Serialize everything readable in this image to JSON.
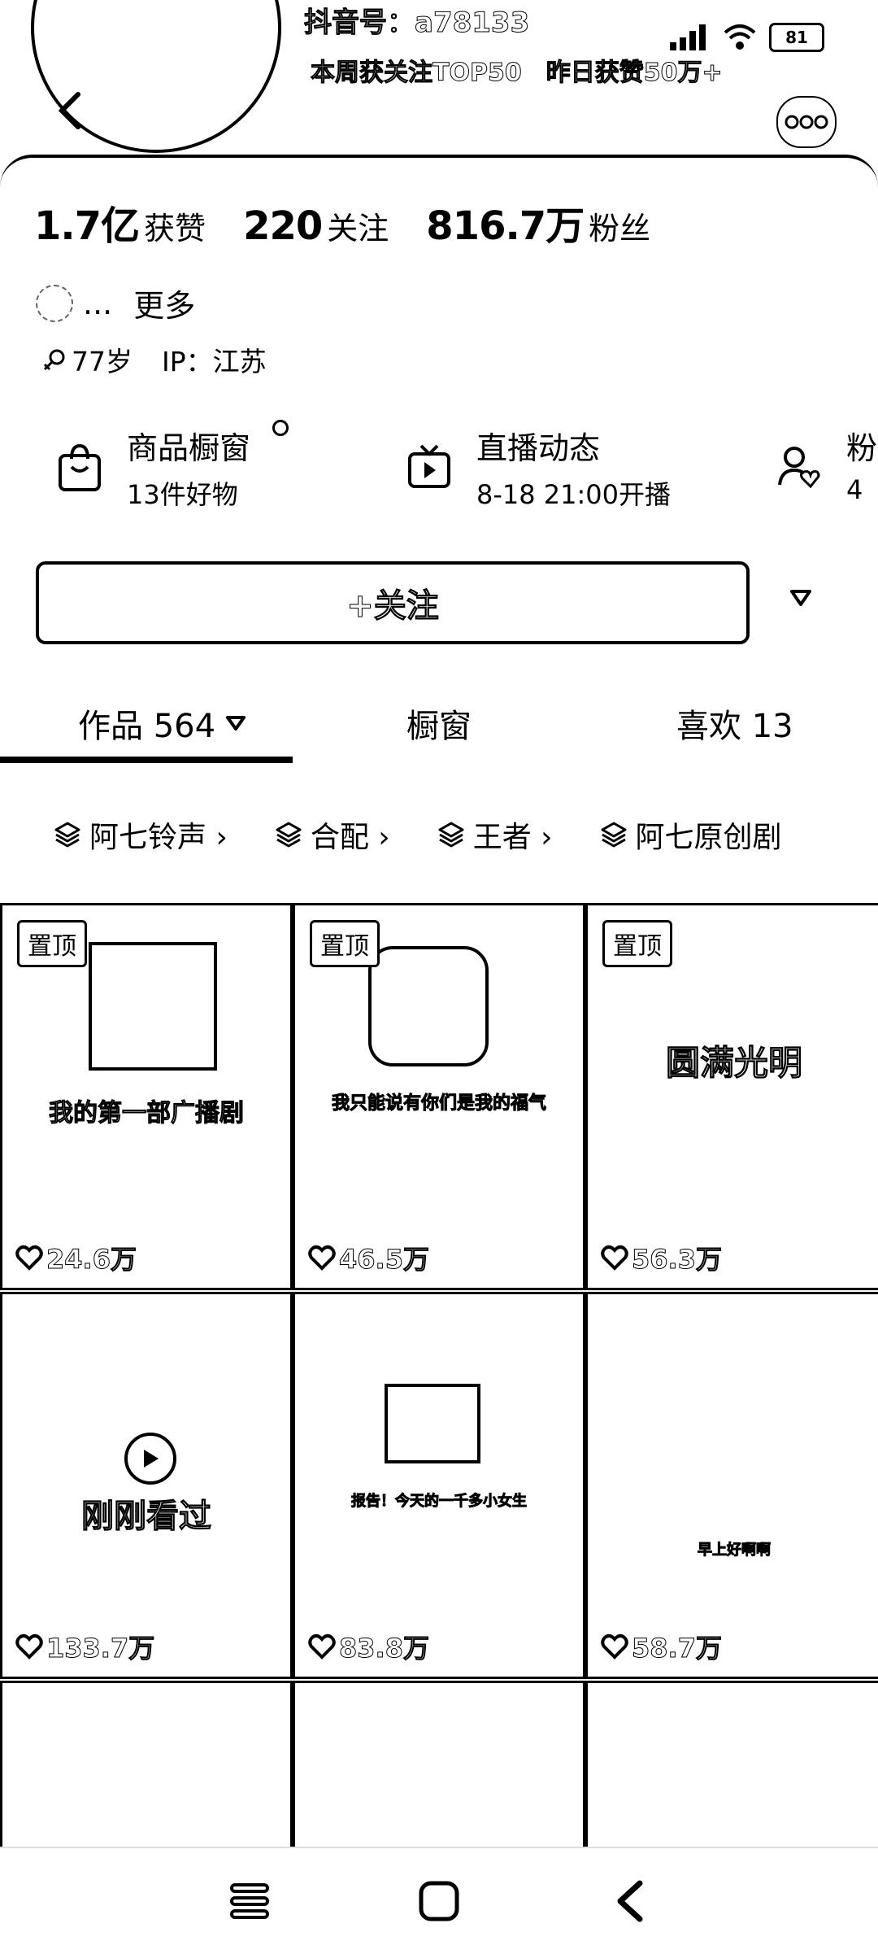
{
  "header": {
    "douyin_id": "抖音号：a78133",
    "rank_badges": "本周获关注TOP50　昨日获赞50万+",
    "battery": "81"
  },
  "stats": {
    "likes_num": "1.7亿",
    "likes_label": "获赞",
    "following_num": "220",
    "following_label": "关注",
    "fans_num": "816.7万",
    "fans_label": "粉丝"
  },
  "bio": {
    "text": "...",
    "more": "更多"
  },
  "info": {
    "age": "77岁",
    "ip": "IP：江苏"
  },
  "features": [
    {
      "title": "商品橱窗",
      "sub": "13件好物",
      "icon": "shopping-bag-icon"
    },
    {
      "title": "直播动态",
      "sub": "8-18 21:00开播",
      "icon": "tv-icon"
    },
    {
      "title": "粉",
      "sub": "4",
      "icon": "user-heart-icon"
    }
  ],
  "follow_button": "+关注",
  "tabs": [
    {
      "label": "作品 564"
    },
    {
      "label": "橱窗"
    },
    {
      "label": "喜欢 13"
    }
  ],
  "chips": [
    "阿七铃声 ›",
    "合配 ›",
    "王者 ›",
    "阿七原创剧"
  ],
  "videos": [
    {
      "pinned": "置顶",
      "caption": "我的第一部广播剧",
      "likes": "24.6万"
    },
    {
      "pinned": "置顶",
      "caption": "我只能说有你们是我的福气",
      "likes": "46.5万"
    },
    {
      "pinned": "置顶",
      "caption": "圆满光明",
      "likes": "56.3万"
    },
    {
      "caption": "刚刚看过",
      "likes": "133.7万"
    },
    {
      "caption": "报告！今天的一千多小女生",
      "likes": "83.8万"
    },
    {
      "caption": "早上好啊啊",
      "likes": "58.7万"
    },
    {},
    {},
    {}
  ]
}
